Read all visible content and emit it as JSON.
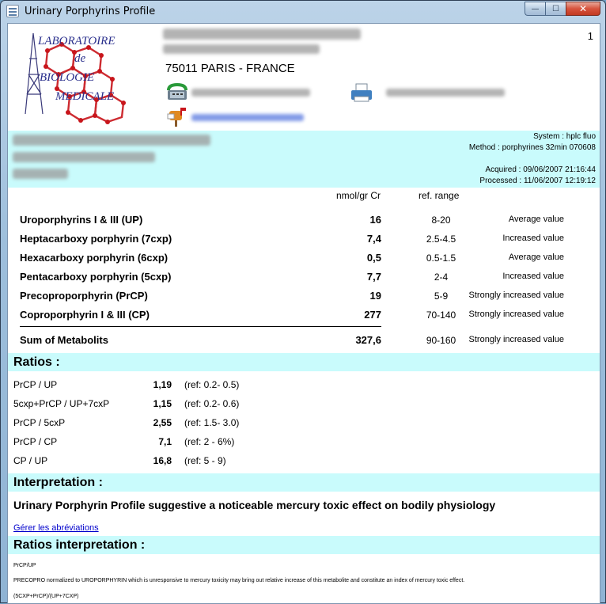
{
  "window": {
    "title": "Urinary Porphyrins Profile",
    "buttons": {
      "minimize": "—",
      "maximize": "☐",
      "close": "✕"
    }
  },
  "header": {
    "page_number": "1",
    "logo": {
      "line1": "LABORATOIRE",
      "line2": "de",
      "line3": "BIOLOGIE",
      "line4": "MEDICALE"
    },
    "city": "75011 PARIS - FRANCE"
  },
  "system": {
    "system": "System : hplc fluo",
    "method": "Method : porphyrines 32min 070608",
    "acquired": "Acquired : 09/06/2007 21:16:44",
    "processed": "Processed : 11/06/2007 12:19:12"
  },
  "results": {
    "col_unit": "nmol/gr Cr",
    "col_ref": "ref. range",
    "rows": [
      {
        "name": "Uroporphyrins I & III (UP)",
        "value": "16",
        "ref": "8-20",
        "status": "Average value"
      },
      {
        "name": "Heptacarboxy porphyrin (7cxp)",
        "value": "7,4",
        "ref": "2.5-4.5",
        "status": "Increased value"
      },
      {
        "name": "Hexacarboxy porphyrin (6cxp)",
        "value": "0,5",
        "ref": "0.5-1.5",
        "status": "Average value"
      },
      {
        "name": "Pentacarboxy porphyrin (5cxp)",
        "value": "7,7",
        "ref": "2-4",
        "status": "Increased value"
      },
      {
        "name": "Precoproporphyrin (PrCP)",
        "value": "19",
        "ref": "5-9",
        "status": "Strongly increased value"
      },
      {
        "name": "Coproporphyrin I & III (CP)",
        "value": "277",
        "ref": "70-140",
        "status": "Strongly increased value"
      }
    ],
    "sum": {
      "name": "Sum of Metabolits",
      "value": "327,6",
      "ref": "90-160",
      "status": "Strongly increased value"
    }
  },
  "ratios": {
    "heading": "Ratios :",
    "rows": [
      {
        "name": "PrCP / UP",
        "value": "1,19",
        "ref": "(ref: 0.2- 0.5)"
      },
      {
        "name": "5cxp+PrCP / UP+7cxP",
        "value": "1,15",
        "ref": "(ref: 0.2- 0.6)"
      },
      {
        "name": "PrCP / 5cxP",
        "value": "2,55",
        "ref": "(ref: 1.5- 3.0)"
      },
      {
        "name": "PrCP / CP",
        "value": "7,1",
        "ref": "(ref: 2 - 6%)"
      },
      {
        "name": "CP / UP",
        "value": "16,8",
        "ref": "(ref: 5 - 9)"
      }
    ]
  },
  "interpretation": {
    "heading": "Interpretation :",
    "text": "Urinary Porphyrin Profile suggestive a noticeable mercury toxic effect on bodily physiology",
    "link": "Gérer les abréviations"
  },
  "ratios_interpretation": {
    "heading": "Ratios interpretation :",
    "item1_title": "PrCP/UP",
    "item1_text": "PRECOPRO normalized to UROPORPHYRIN which is unresponsive to mercury toxicity may bring out relative increase of this metabolite and constitute an index of mercury toxic effect.",
    "item2_title": "(5CXP+PrCP)/(UP+7CXP)"
  },
  "colors": {
    "band": "#c9fbfc",
    "logo_red": "#c8151b",
    "logo_blue": "#2a2f8c",
    "link": "#0000cc"
  }
}
